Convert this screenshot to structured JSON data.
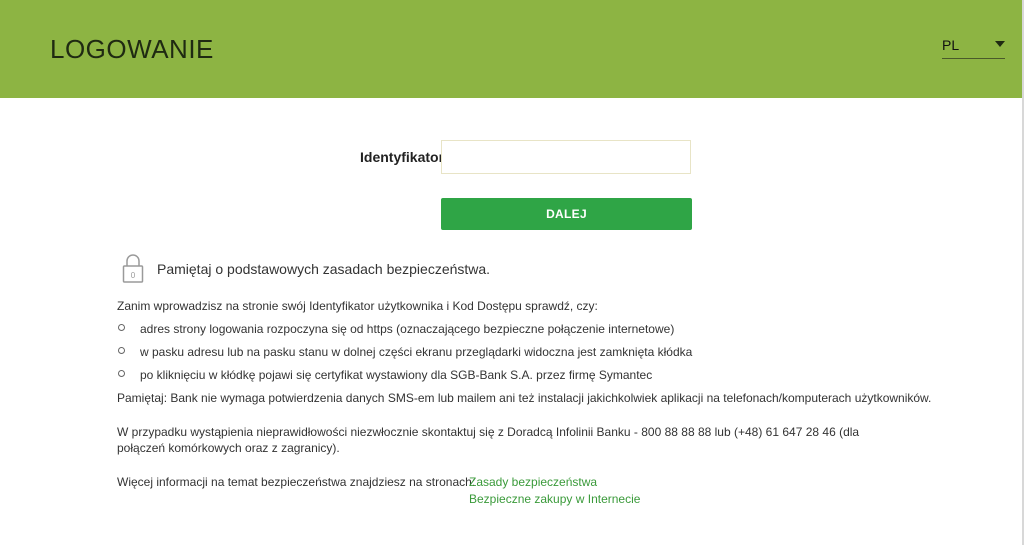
{
  "header": {
    "title": "LOGOWANIE",
    "language": {
      "selected": "PL",
      "icon": "chevron-down-icon"
    },
    "background_color": "#8db443"
  },
  "login_form": {
    "identifier_label": "Identyfikator",
    "identifier_value": "",
    "next_button_label": "DALEJ",
    "button_color": "#2fa546"
  },
  "security": {
    "icon": "lock-icon",
    "lock_glyph": "0",
    "heading": "Pamiętaj o podstawowych zasadach bezpieczeństwa.",
    "intro": "Zanim wprowadzisz na stronie swój Identyfikator użytkownika i Kod Dostępu sprawdź, czy:",
    "checks": [
      "adres strony logowania rozpoczyna się od https (oznaczającego bezpieczne połączenie internetowe)",
      "w pasku adresu lub na pasku stanu w dolnej części ekranu przeglądarki widoczna jest zamknięta kłódka",
      "po kliknięciu w kłódkę pojawi się certyfikat wystawiony dla SGB-Bank S.A. przez firmę Symantec"
    ],
    "remember": "Pamiętaj: Bank nie wymaga potwierdzenia danych SMS-em lub mailem ani też instalacji jakichkolwiek aplikacji na telefonach/komputerach użytkowników.",
    "contact": "W przypadku wystąpienia nieprawidłowości niezwłocznie skontaktuj się z Doradcą Infolinii Banku - 800 88 88 88 lub (+48) 61 647 28 46 (dla połączeń komórkowych oraz z zagranicy).",
    "more_info_label": "Więcej informacji na temat bezpieczeństwa znajdziesz na stronach:",
    "links": [
      "Zasady bezpieczeństwa",
      "Bezpieczne zakupy w Internecie"
    ],
    "link_color": "#3a9a3a"
  }
}
